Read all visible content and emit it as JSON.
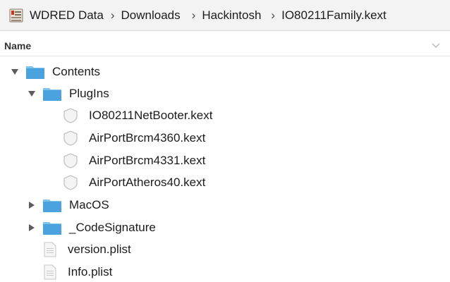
{
  "path": {
    "drive_icon": "external-drive-icon",
    "crumbs": [
      "WDRED Data",
      "Downloads",
      "Hackintosh",
      "IO80211Family.kext"
    ]
  },
  "column_header": {
    "name_label": "Name"
  },
  "rows": [
    {
      "label": "Contents",
      "type": "folder",
      "expanded": true
    },
    {
      "label": "PlugIns",
      "type": "folder",
      "expanded": true
    },
    {
      "label": "IO80211NetBooter.kext",
      "type": "kext"
    },
    {
      "label": "AirPortBrcm4360.kext",
      "type": "kext"
    },
    {
      "label": "AirPortBrcm4331.kext",
      "type": "kext"
    },
    {
      "label": "AirPortAtheros40.kext",
      "type": "kext"
    },
    {
      "label": "MacOS",
      "type": "folder",
      "expanded": false
    },
    {
      "label": "_CodeSignature",
      "type": "folder",
      "expanded": false
    },
    {
      "label": "version.plist",
      "type": "plist"
    },
    {
      "label": "Info.plist",
      "type": "plist"
    }
  ],
  "colors": {
    "folder": "#4aa3df",
    "folder_tab": "#7cc3ee",
    "kext": "#cfcfcf",
    "path_bar": "#f3f3f3"
  }
}
